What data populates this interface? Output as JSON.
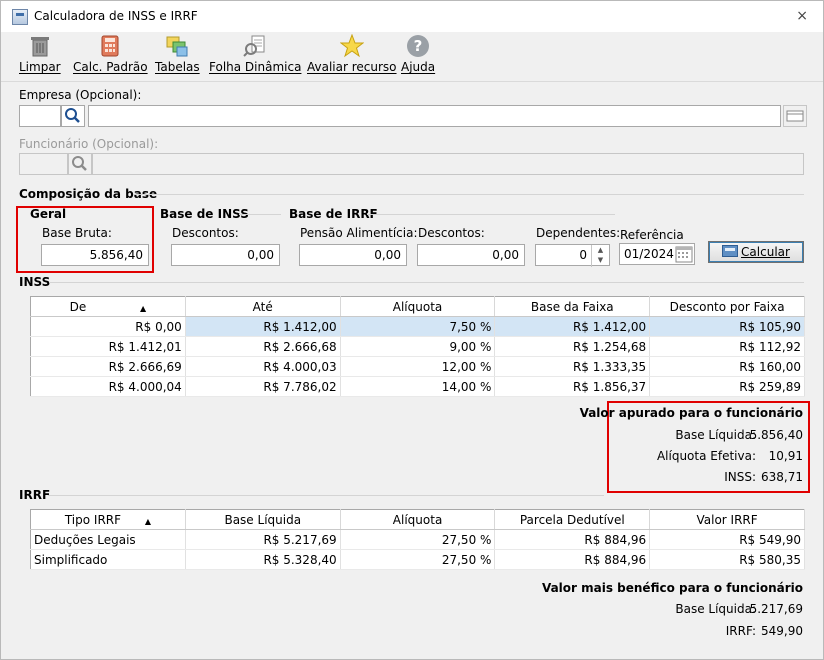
{
  "window": {
    "title": "Calculadora de INSS e IRRF",
    "close_glyph": "×"
  },
  "toolbar": {
    "items": [
      {
        "label": "Limpar",
        "icon": "trash-icon"
      },
      {
        "label": "Calc. Padrão",
        "icon": "calculator-icon"
      },
      {
        "label": "Tabelas",
        "icon": "tables-icon"
      },
      {
        "label": "Folha Dinâmica",
        "icon": "dynamic-sheet-icon"
      },
      {
        "label": "Avaliar recurso",
        "icon": "star-icon"
      },
      {
        "label": "Ajuda",
        "icon": "help-icon"
      }
    ]
  },
  "empresa": {
    "label": "Empresa (Opcional):",
    "code": "",
    "name": ""
  },
  "funcionario": {
    "label": "Funcionário (Opcional):",
    "code": "",
    "name": ""
  },
  "composicao": {
    "section_label": "Composição da base",
    "geral": {
      "title": "Geral",
      "base_bruta_label": "Base Bruta:",
      "base_bruta": "5.856,40"
    },
    "base_inss": {
      "title": "Base de INSS",
      "descontos_label": "Descontos:",
      "descontos": "0,00"
    },
    "base_irrf": {
      "title": "Base de IRRF",
      "pensao_label": "Pensão Alimentícia:",
      "pensao": "0,00",
      "descontos_label": "Descontos:",
      "descontos": "0,00",
      "dependentes_label": "Dependentes:",
      "dependentes": "0"
    },
    "referencia_label": "Referência",
    "referencia": "01/2024",
    "calcular_label": "Calcular"
  },
  "inss": {
    "section_label": "INSS",
    "columns": [
      "De",
      "Até",
      "Alíquota",
      "Base da Faixa",
      "Desconto por Faixa"
    ],
    "rows": [
      [
        "R$ 0,00",
        "R$ 1.412,00",
        "7,50 %",
        "R$ 1.412,00",
        "R$ 105,90"
      ],
      [
        "R$ 1.412,01",
        "R$ 2.666,68",
        "9,00 %",
        "R$ 1.254,68",
        "R$ 112,92"
      ],
      [
        "R$ 2.666,69",
        "R$ 4.000,03",
        "12,00 %",
        "R$ 1.333,35",
        "R$ 160,00"
      ],
      [
        "R$ 4.000,04",
        "R$ 7.786,02",
        "14,00 %",
        "R$ 1.856,37",
        "R$ 259,89"
      ]
    ],
    "summary": {
      "title": "Valor apurado para o funcionário",
      "base_liquida_label": "Base Líquida:",
      "base_liquida": "5.856,40",
      "aliquota_label": "Alíquota Efetiva:",
      "aliquota": "10,91",
      "inss_label": "INSS:",
      "inss": "638,71"
    }
  },
  "irrf": {
    "section_label": "IRRF",
    "columns": [
      "Tipo IRRF",
      "Base Líquida",
      "Alíquota",
      "Parcela Dedutível",
      "Valor IRRF"
    ],
    "rows": [
      [
        "Deduções Legais",
        "R$ 5.217,69",
        "27,50 %",
        "R$ 884,96",
        "R$ 549,90"
      ],
      [
        "Simplificado",
        "R$ 5.328,40",
        "27,50 %",
        "R$ 884,96",
        "R$ 580,35"
      ]
    ],
    "summary": {
      "title": "Valor mais benéfico para o funcionário",
      "base_liquida_label": "Base Líquida:",
      "base_liquida": "5.217,69",
      "irrf_label": "IRRF:",
      "irrf": "549,90"
    }
  },
  "colors": {
    "highlight_red": "#e00000",
    "selection": "#d3e5f5"
  }
}
